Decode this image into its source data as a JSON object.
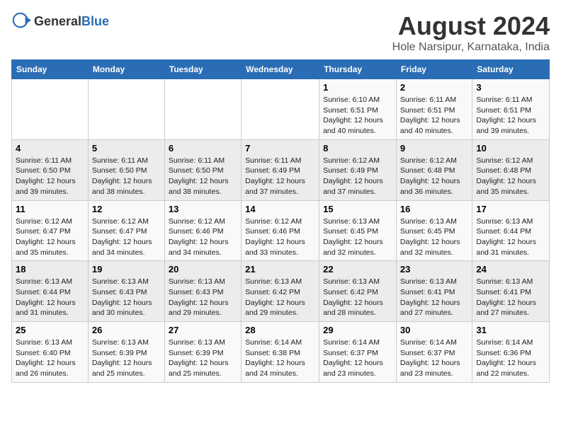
{
  "header": {
    "logo_general": "General",
    "logo_blue": "Blue",
    "month_title": "August 2024",
    "location": "Hole Narsipur, Karnataka, India"
  },
  "columns": [
    "Sunday",
    "Monday",
    "Tuesday",
    "Wednesday",
    "Thursday",
    "Friday",
    "Saturday"
  ],
  "weeks": [
    [
      {
        "day": "",
        "info": ""
      },
      {
        "day": "",
        "info": ""
      },
      {
        "day": "",
        "info": ""
      },
      {
        "day": "",
        "info": ""
      },
      {
        "day": "1",
        "info": "Sunrise: 6:10 AM\nSunset: 6:51 PM\nDaylight: 12 hours and 40 minutes."
      },
      {
        "day": "2",
        "info": "Sunrise: 6:11 AM\nSunset: 6:51 PM\nDaylight: 12 hours and 40 minutes."
      },
      {
        "day": "3",
        "info": "Sunrise: 6:11 AM\nSunset: 6:51 PM\nDaylight: 12 hours and 39 minutes."
      }
    ],
    [
      {
        "day": "4",
        "info": "Sunrise: 6:11 AM\nSunset: 6:50 PM\nDaylight: 12 hours and 39 minutes."
      },
      {
        "day": "5",
        "info": "Sunrise: 6:11 AM\nSunset: 6:50 PM\nDaylight: 12 hours and 38 minutes."
      },
      {
        "day": "6",
        "info": "Sunrise: 6:11 AM\nSunset: 6:50 PM\nDaylight: 12 hours and 38 minutes."
      },
      {
        "day": "7",
        "info": "Sunrise: 6:11 AM\nSunset: 6:49 PM\nDaylight: 12 hours and 37 minutes."
      },
      {
        "day": "8",
        "info": "Sunrise: 6:12 AM\nSunset: 6:49 PM\nDaylight: 12 hours and 37 minutes."
      },
      {
        "day": "9",
        "info": "Sunrise: 6:12 AM\nSunset: 6:48 PM\nDaylight: 12 hours and 36 minutes."
      },
      {
        "day": "10",
        "info": "Sunrise: 6:12 AM\nSunset: 6:48 PM\nDaylight: 12 hours and 35 minutes."
      }
    ],
    [
      {
        "day": "11",
        "info": "Sunrise: 6:12 AM\nSunset: 6:47 PM\nDaylight: 12 hours and 35 minutes."
      },
      {
        "day": "12",
        "info": "Sunrise: 6:12 AM\nSunset: 6:47 PM\nDaylight: 12 hours and 34 minutes."
      },
      {
        "day": "13",
        "info": "Sunrise: 6:12 AM\nSunset: 6:46 PM\nDaylight: 12 hours and 34 minutes."
      },
      {
        "day": "14",
        "info": "Sunrise: 6:12 AM\nSunset: 6:46 PM\nDaylight: 12 hours and 33 minutes."
      },
      {
        "day": "15",
        "info": "Sunrise: 6:13 AM\nSunset: 6:45 PM\nDaylight: 12 hours and 32 minutes."
      },
      {
        "day": "16",
        "info": "Sunrise: 6:13 AM\nSunset: 6:45 PM\nDaylight: 12 hours and 32 minutes."
      },
      {
        "day": "17",
        "info": "Sunrise: 6:13 AM\nSunset: 6:44 PM\nDaylight: 12 hours and 31 minutes."
      }
    ],
    [
      {
        "day": "18",
        "info": "Sunrise: 6:13 AM\nSunset: 6:44 PM\nDaylight: 12 hours and 31 minutes."
      },
      {
        "day": "19",
        "info": "Sunrise: 6:13 AM\nSunset: 6:43 PM\nDaylight: 12 hours and 30 minutes."
      },
      {
        "day": "20",
        "info": "Sunrise: 6:13 AM\nSunset: 6:43 PM\nDaylight: 12 hours and 29 minutes."
      },
      {
        "day": "21",
        "info": "Sunrise: 6:13 AM\nSunset: 6:42 PM\nDaylight: 12 hours and 29 minutes."
      },
      {
        "day": "22",
        "info": "Sunrise: 6:13 AM\nSunset: 6:42 PM\nDaylight: 12 hours and 28 minutes."
      },
      {
        "day": "23",
        "info": "Sunrise: 6:13 AM\nSunset: 6:41 PM\nDaylight: 12 hours and 27 minutes."
      },
      {
        "day": "24",
        "info": "Sunrise: 6:13 AM\nSunset: 6:41 PM\nDaylight: 12 hours and 27 minutes."
      }
    ],
    [
      {
        "day": "25",
        "info": "Sunrise: 6:13 AM\nSunset: 6:40 PM\nDaylight: 12 hours and 26 minutes."
      },
      {
        "day": "26",
        "info": "Sunrise: 6:13 AM\nSunset: 6:39 PM\nDaylight: 12 hours and 25 minutes."
      },
      {
        "day": "27",
        "info": "Sunrise: 6:13 AM\nSunset: 6:39 PM\nDaylight: 12 hours and 25 minutes."
      },
      {
        "day": "28",
        "info": "Sunrise: 6:14 AM\nSunset: 6:38 PM\nDaylight: 12 hours and 24 minutes."
      },
      {
        "day": "29",
        "info": "Sunrise: 6:14 AM\nSunset: 6:37 PM\nDaylight: 12 hours and 23 minutes."
      },
      {
        "day": "30",
        "info": "Sunrise: 6:14 AM\nSunset: 6:37 PM\nDaylight: 12 hours and 23 minutes."
      },
      {
        "day": "31",
        "info": "Sunrise: 6:14 AM\nSunset: 6:36 PM\nDaylight: 12 hours and 22 minutes."
      }
    ]
  ]
}
